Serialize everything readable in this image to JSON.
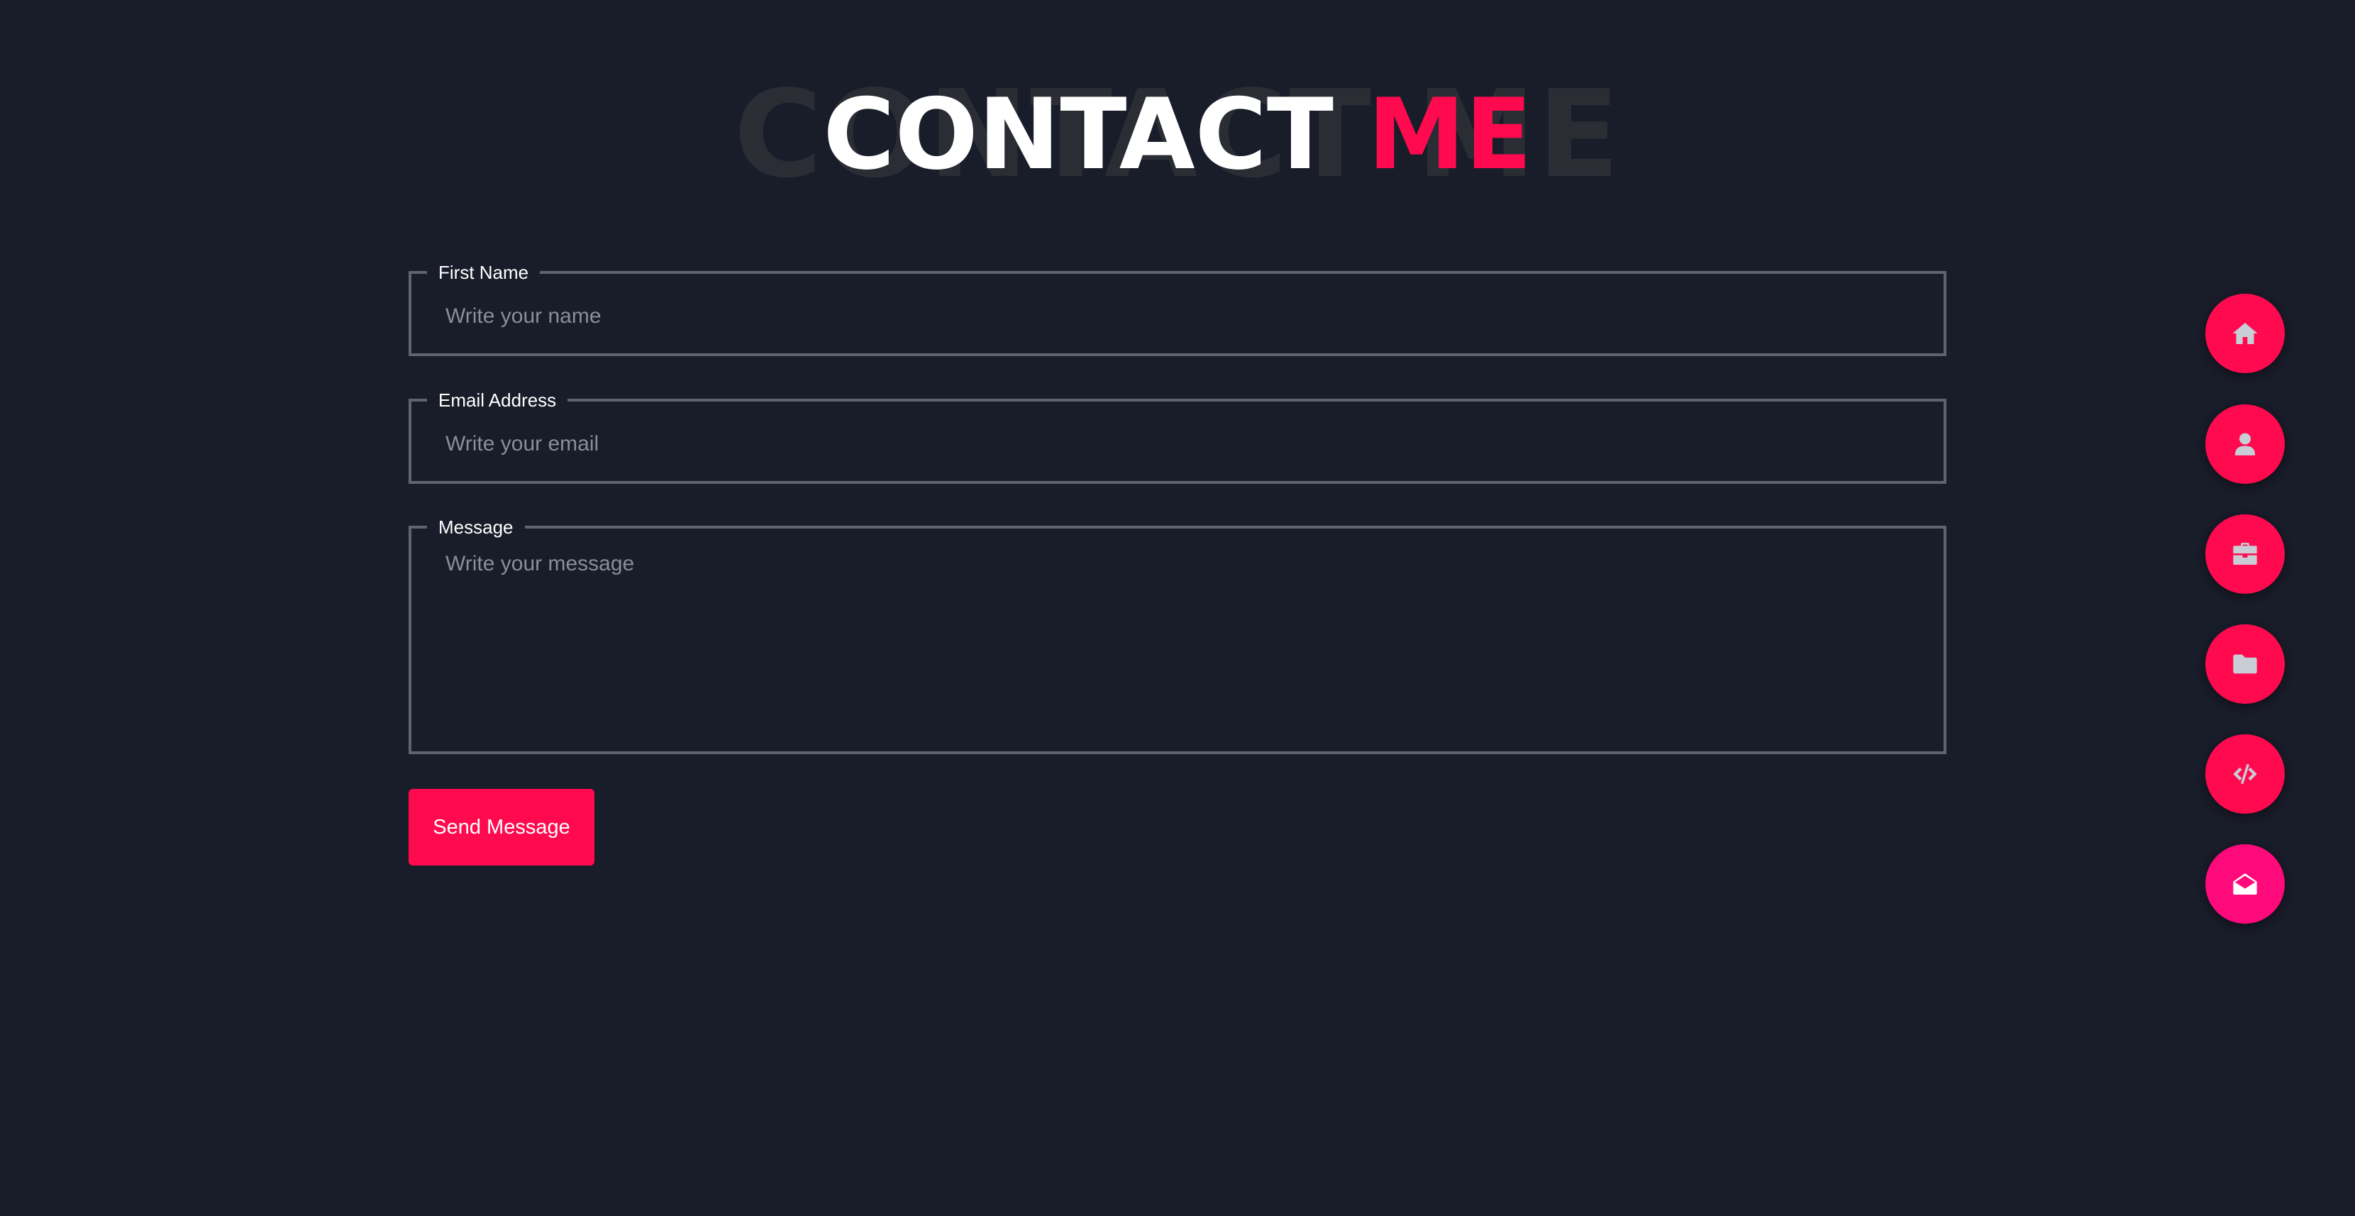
{
  "heading": {
    "background_text": "CONTACT ME",
    "title_main": "CONTACT",
    "title_accent": "ME"
  },
  "form": {
    "name": {
      "label": "First Name",
      "placeholder": "Write your name",
      "value": ""
    },
    "email": {
      "label": "Email Address",
      "placeholder": "Write your email",
      "value": ""
    },
    "message": {
      "label": "Message",
      "placeholder": "Write your message",
      "value": ""
    },
    "submit_label": "Send Message"
  },
  "nav": {
    "items": [
      {
        "icon": "home-icon",
        "active": false
      },
      {
        "icon": "user-icon",
        "active": false
      },
      {
        "icon": "briefcase-icon",
        "active": false
      },
      {
        "icon": "folder-icon",
        "active": false
      },
      {
        "icon": "code-icon",
        "active": false
      },
      {
        "icon": "envelope-open-icon",
        "active": true
      }
    ]
  },
  "colors": {
    "background": "#191c29",
    "accent": "#ff0a4f",
    "active_nav": "#ff0a7a",
    "field_border": "#5d6570",
    "heading_shadow": "#2a2d34"
  }
}
